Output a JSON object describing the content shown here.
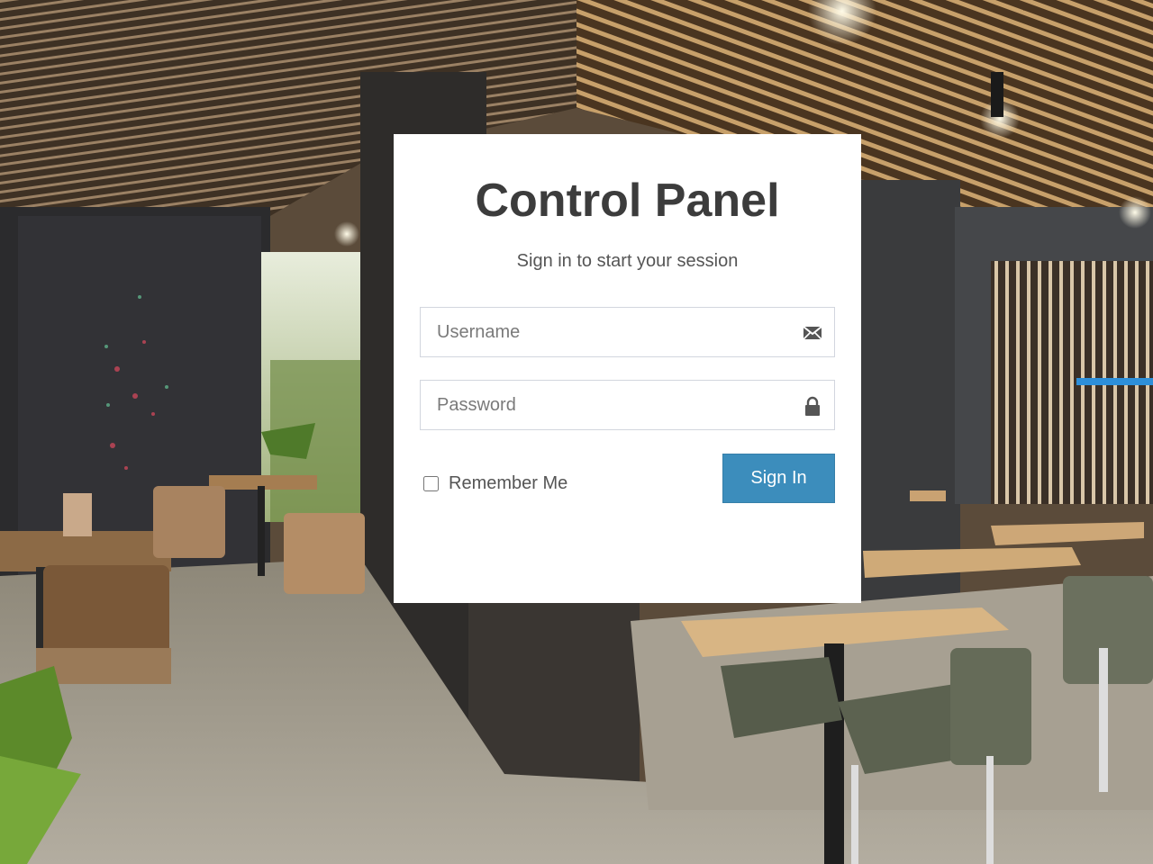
{
  "login": {
    "title": "Control Panel",
    "subtitle": "Sign in to start your session",
    "username_placeholder": "Username",
    "password_placeholder": "Password",
    "remember_label": "Remember Me",
    "signin_label": "Sign In"
  },
  "icons": {
    "username": "envelope-icon",
    "password": "lock-icon"
  },
  "colors": {
    "accent": "#3c8dbc",
    "title": "#3c3c3c",
    "card": "#ffffff"
  }
}
